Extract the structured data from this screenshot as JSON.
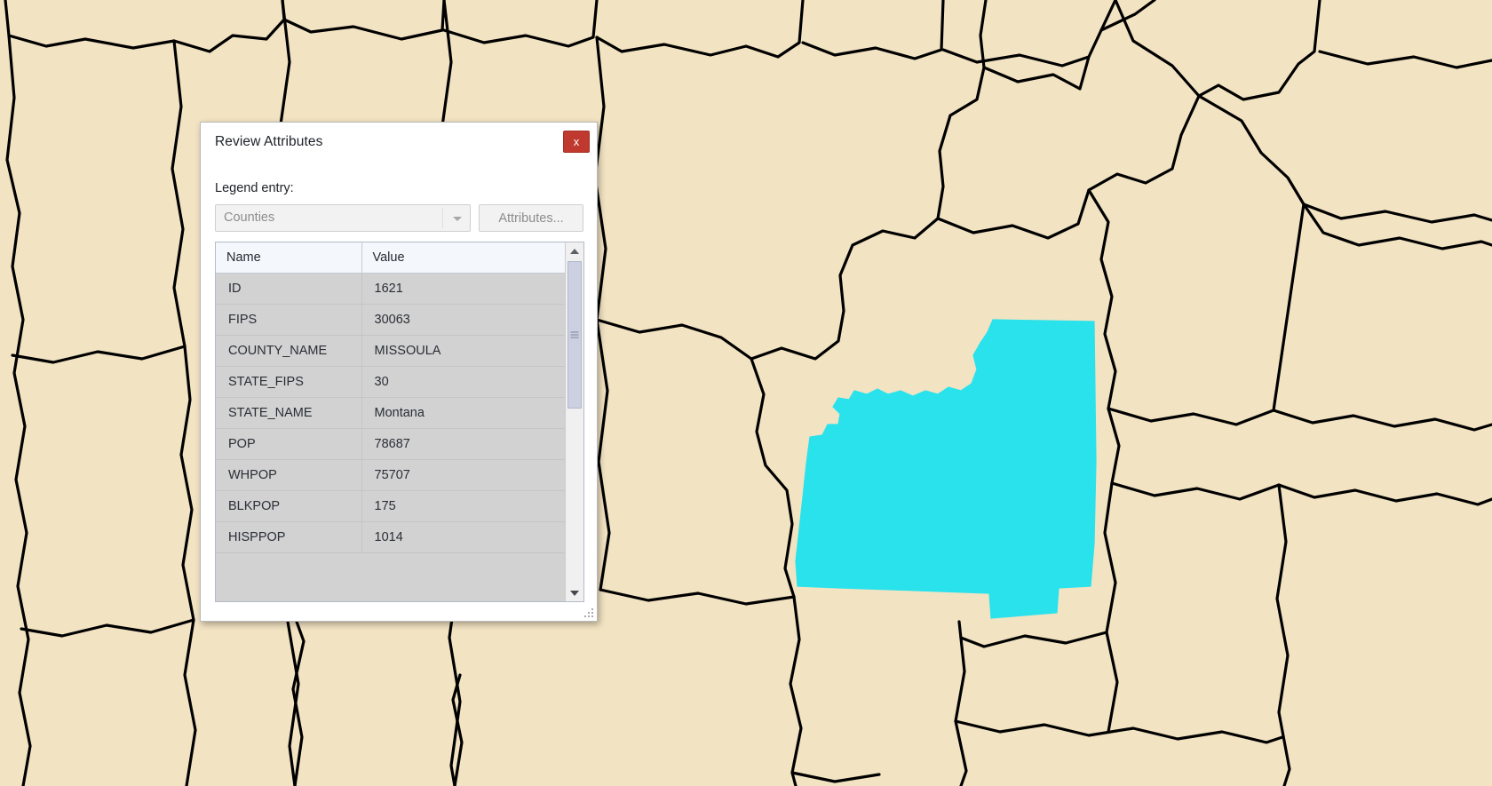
{
  "map": {
    "background_color": "#f2e3c2",
    "boundary_color": "#000000",
    "highlight_color": "#2ae2ec",
    "selected_feature": "MISSOULA"
  },
  "dialog": {
    "title": "Review Attributes",
    "close_label": "x",
    "legend_entry_label": "Legend entry:",
    "legend_entry_value": "Counties",
    "attributes_button_label": "Attributes...",
    "table": {
      "columns": [
        "Name",
        "Value"
      ],
      "rows": [
        {
          "name": "ID",
          "value": "1621"
        },
        {
          "name": "FIPS",
          "value": "30063"
        },
        {
          "name": "COUNTY_NAME",
          "value": "MISSOULA"
        },
        {
          "name": "STATE_FIPS",
          "value": "30"
        },
        {
          "name": "STATE_NAME",
          "value": "Montana"
        },
        {
          "name": "POP",
          "value": "78687"
        },
        {
          "name": "WHPOP",
          "value": "75707"
        },
        {
          "name": "BLKPOP",
          "value": "175"
        },
        {
          "name": "HISPPOP",
          "value": "1014"
        }
      ]
    }
  }
}
